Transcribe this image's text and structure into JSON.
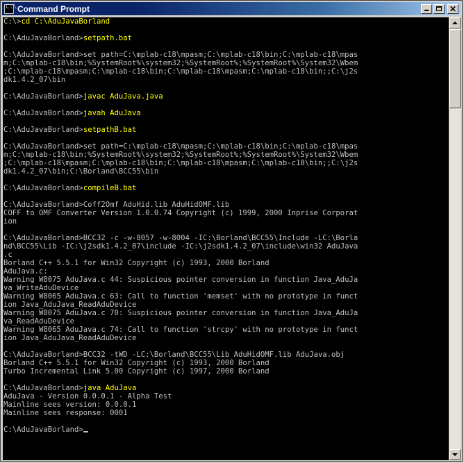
{
  "window": {
    "title": "Command Prompt",
    "icon_text": "C:\\"
  },
  "console": {
    "lines": [
      {
        "prompt": "C:\\>",
        "cmd": "cd C:\\AduJavaBorland"
      },
      {
        "text": ""
      },
      {
        "prompt": "C:\\AduJavaBorland>",
        "cmd": "setpath.bat"
      },
      {
        "text": ""
      },
      {
        "text": "C:\\AduJavaBorland>set path=C:\\mplab-c18\\mpasm;C:\\mplab-c18\\bin;C:\\mplab-c18\\mpas"
      },
      {
        "text": "m;C:\\mplab-c18\\bin;%SystemRoot%\\system32;%SystemRoot%;%SystemRoot%\\System32\\Wbem"
      },
      {
        "text": ";C:\\mplab-c18\\mpasm;C:\\mplab-c18\\bin;C:\\mplab-c18\\mpasm;C:\\mplab-c18\\bin;;C:\\j2s"
      },
      {
        "text": "dk1.4.2_07\\bin"
      },
      {
        "text": ""
      },
      {
        "prompt": "C:\\AduJavaBorland>",
        "cmd": "javac AduJava.java"
      },
      {
        "text": ""
      },
      {
        "prompt": "C:\\AduJavaBorland>",
        "cmd": "javah AduJava"
      },
      {
        "text": ""
      },
      {
        "prompt": "C:\\AduJavaBorland>",
        "cmd": "setpathB.bat"
      },
      {
        "text": ""
      },
      {
        "text": "C:\\AduJavaBorland>set path=C:\\mplab-c18\\mpasm;C:\\mplab-c18\\bin;C:\\mplab-c18\\mpas"
      },
      {
        "text": "m;C:\\mplab-c18\\bin;%SystemRoot%\\system32;%SystemRoot%;%SystemRoot%\\System32\\Wbem"
      },
      {
        "text": ";C:\\mplab-c18\\mpasm;C:\\mplab-c18\\bin;C:\\mplab-c18\\mpasm;C:\\mplab-c18\\bin;;C:\\j2s"
      },
      {
        "text": "dk1.4.2_07\\bin;C:\\Borland\\BCC55\\bin"
      },
      {
        "text": ""
      },
      {
        "prompt": "C:\\AduJavaBorland>",
        "cmd": "compileB.bat"
      },
      {
        "text": ""
      },
      {
        "text": "C:\\AduJavaBorland>Coff2Omf AduHid.lib AduHidOMF.lib"
      },
      {
        "text": "COFF to OMF Converter Version 1.0.0.74 Copyright (c) 1999, 2000 Inprise Corporat"
      },
      {
        "text": "ion"
      },
      {
        "text": ""
      },
      {
        "text": "C:\\AduJavaBorland>BCC32 -c -w-8057 -w-8004 -IC:\\Borland\\BCC55\\Include -LC:\\Borla"
      },
      {
        "text": "nd\\BCC55\\Lib -IC:\\j2sdk1.4.2_07\\include -IC:\\j2sdk1.4.2_07\\include\\win32 AduJava"
      },
      {
        "text": ".c"
      },
      {
        "text": "Borland C++ 5.5.1 for Win32 Copyright (c) 1993, 2000 Borland"
      },
      {
        "text": "AduJava.c:"
      },
      {
        "text": "Warning W8075 AduJava.c 44: Suspicious pointer conversion in function Java_AduJa"
      },
      {
        "text": "va_WriteAduDevice"
      },
      {
        "text": "Warning W8065 AduJava.c 63: Call to function 'memset' with no prototype in funct"
      },
      {
        "text": "ion Java_AduJava_ReadAduDevice"
      },
      {
        "text": "Warning W8075 AduJava.c 70: Suspicious pointer conversion in function Java_AduJa"
      },
      {
        "text": "va_ReadAduDevice"
      },
      {
        "text": "Warning W8065 AduJava.c 74: Call to function 'strcpy' with no prototype in funct"
      },
      {
        "text": "ion Java_AduJava_ReadAduDevice"
      },
      {
        "text": ""
      },
      {
        "text": "C:\\AduJavaBorland>BCC32 -tWD -LC:\\Borland\\BCC55\\Lib AduHidOMF.lib AduJava.obj"
      },
      {
        "text": "Borland C++ 5.5.1 for Win32 Copyright (c) 1993, 2000 Borland"
      },
      {
        "text": "Turbo Incremental Link 5.00 Copyright (c) 1997, 2000 Borland"
      },
      {
        "text": ""
      },
      {
        "prompt": "C:\\AduJavaBorland>",
        "cmd": "java AduJava"
      },
      {
        "text": "AduJava - Version 0.0.0.1 - Alpha Test"
      },
      {
        "text": "Mainline sees version: 0.0.0.1"
      },
      {
        "text": "Mainline sees response: 0001"
      },
      {
        "text": ""
      },
      {
        "prompt": "C:\\AduJavaBorland>",
        "cmd": "",
        "cursor": true
      }
    ]
  },
  "colors": {
    "console_bg": "#000000",
    "console_text": "#c0c0c0",
    "command_text": "#ffff00",
    "titlebar_start": "#0a246a",
    "titlebar_end": "#a6caf0"
  }
}
